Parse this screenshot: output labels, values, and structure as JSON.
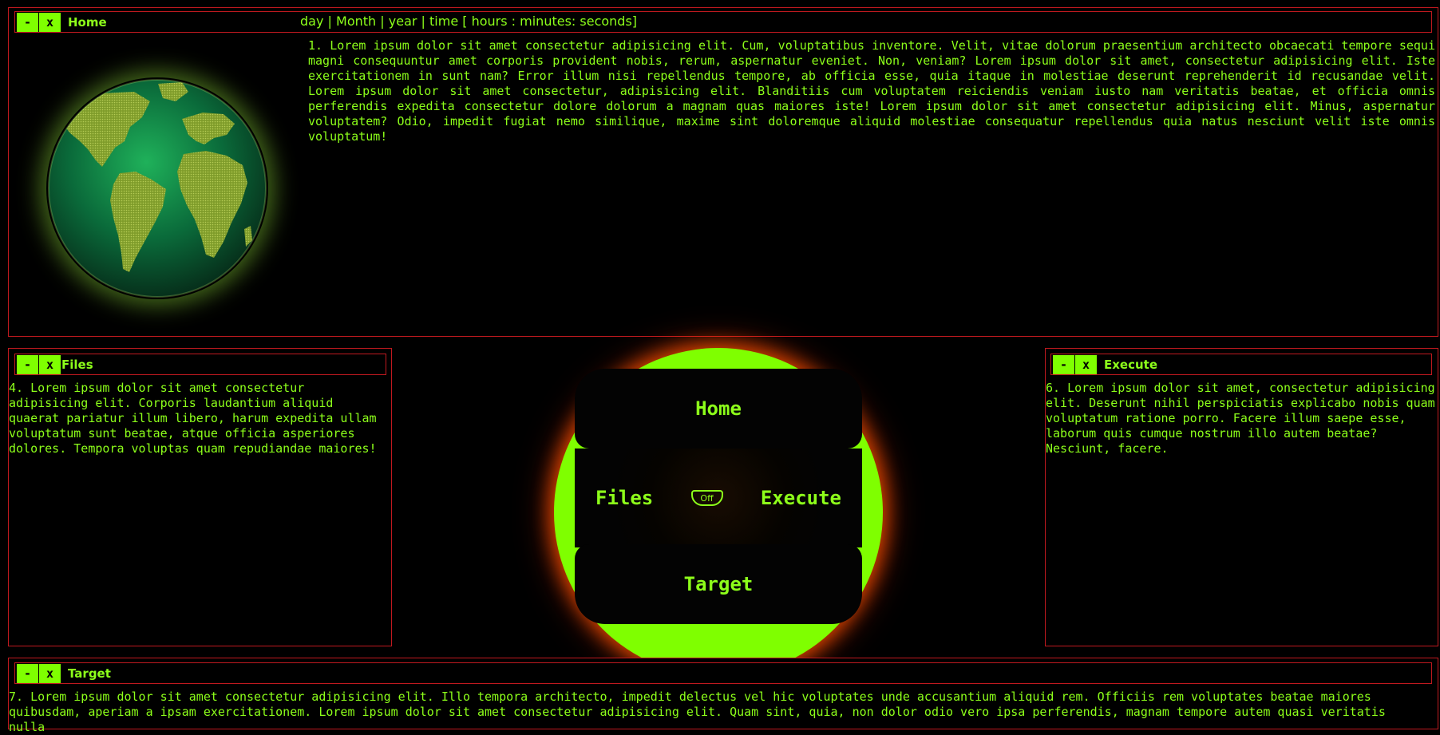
{
  "home": {
    "title": "Home",
    "minimize": "-",
    "close": "x",
    "datebar": {
      "day": "day",
      "month": "Month",
      "year": "year",
      "time": "time [ hours : minutes: seconds]",
      "sep": "|"
    },
    "text": "1. Lorem ipsum dolor sit amet consectetur adipisicing elit. Cum, voluptatibus inventore. Velit, vitae dolorum praesentium architecto obcaecati tempore sequi magni consequuntur amet corporis provident nobis, rerum, aspernatur eveniet. Non, veniam? Lorem ipsum dolor sit amet, consectetur adipisicing elit. Iste exercitationem in sunt nam? Error illum nisi repellendus tempore, ab officia esse, quia itaque in molestiae deserunt reprehenderit id recusandae velit. Lorem ipsum dolor sit amet consectetur, adipisicing elit. Blanditiis cum voluptatem reiciendis veniam iusto nam veritatis beatae, et officia omnis perferendis expedita consectetur dolore dolorum a magnam quas maiores iste! Lorem ipsum dolor sit amet consectetur adipisicing elit. Minus, aspernatur voluptatem? Odio, impedit fugiat nemo similique, maxime sint doloremque aliquid molestiae consequatur repellendus quia natus nesciunt velit iste omnis voluptatum!"
  },
  "files": {
    "title": "Files",
    "minimize": "-",
    "close": "x",
    "text": "4. Lorem ipsum dolor sit amet consectetur adipisicing elit. Corporis laudantium aliquid quaerat pariatur illum libero, harum expedita ullam voluptatum sunt beatae, atque officia asperiores dolores. Tempora voluptas quam repudiandae maiores!"
  },
  "execute": {
    "title": "Execute",
    "minimize": "-",
    "close": "x",
    "text": "6. Lorem ipsum dolor sit amet, consectetur adipisicing elit. Deserunt nihil perspiciatis explicabo nobis quam voluptatum ratione porro. Facere illum saepe esse, laborum quis cumque nostrum illo autem beatae? Nesciunt, facere."
  },
  "target": {
    "title": "Target",
    "minimize": "-",
    "close": "x",
    "text": "7. Lorem ipsum dolor sit amet consectetur adipisicing elit. Illo tempora architecto, impedit delectus vel hic voluptates unde accusantium aliquid rem. Officiis rem voluptates beatae maiores quibusdam, aperiam a ipsam exercitationem. Lorem ipsum dolor sit amet consectetur adipisicing elit. Quam sint, quia, non dolor odio vero ipsa perferendis, magnam tempore autem quasi veritatis nulla"
  },
  "dial": {
    "home": "Home",
    "files": "Files",
    "execute": "Execute",
    "target": "Target",
    "toggle": "Off"
  },
  "colors": {
    "accent": "#7fff00",
    "text": "#8dff1a",
    "border": "#c0191f",
    "background": "#000000",
    "glow": "#ff5000"
  },
  "icons": {
    "globe": "globe-icon"
  }
}
